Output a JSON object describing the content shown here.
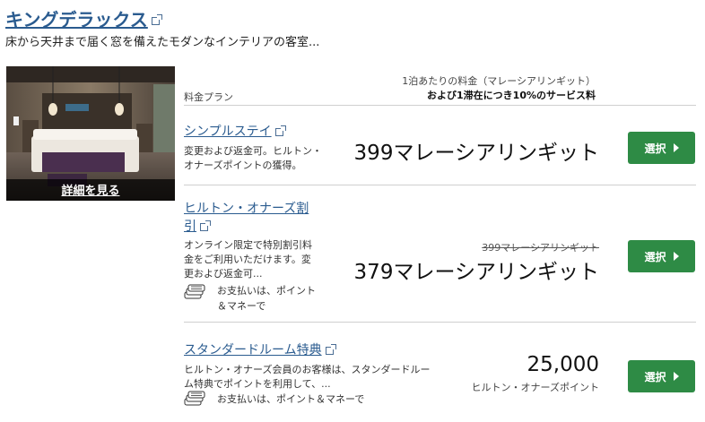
{
  "room": {
    "title": "キングデラックス",
    "description": "床から天井まで届く窓を備えたモダンなインテリアの客室...",
    "photo_link": "詳細を見る"
  },
  "table_header": {
    "plan_label": "料金プラン",
    "rate_line1": "1泊あたりの料金（マレーシアリンギット）",
    "rate_line2": "および1滞在につき10%のサービス料"
  },
  "plans": [
    {
      "name": "シンプルステイ",
      "description_lines": [
        "変更および返金可。ヒルトン・",
        "オナーズポイントの獲得。"
      ],
      "price": "399マレーシアリンギット",
      "select_label": "選択"
    },
    {
      "name_line1": "ヒルトン・オナーズ割",
      "name_line2": "引",
      "description_lines": [
        "オンライン限定で特別割引料",
        "金をご利用いただけます。変",
        "更および返金可..."
      ],
      "original_price": "399マレーシアリンギット",
      "price": "379マレーシアリンギット",
      "payment_note_line1": "お支払いは、ポイント",
      "payment_note_line2": "＆マネーで",
      "select_label": "選択"
    },
    {
      "name": "スタンダードルーム特典",
      "description_lines": [
        "ヒルトン・オナーズ会員のお客様は、スタンダードルー",
        "ム特典でポイントを利用して、..."
      ],
      "price": "25,000",
      "price_unit": "ヒルトン・オナーズポイント",
      "payment_note": "お支払いは、ポイント＆マネーで",
      "select_label": "選択"
    }
  ],
  "icons": {
    "external_link": "external-link-icon",
    "select_arrow": "triangle-right-icon",
    "payment": "points-and-money-icon"
  },
  "colors": {
    "link": "#2a5b8f",
    "select_button": "#2e8b45",
    "photo_overlay": "#000000"
  }
}
